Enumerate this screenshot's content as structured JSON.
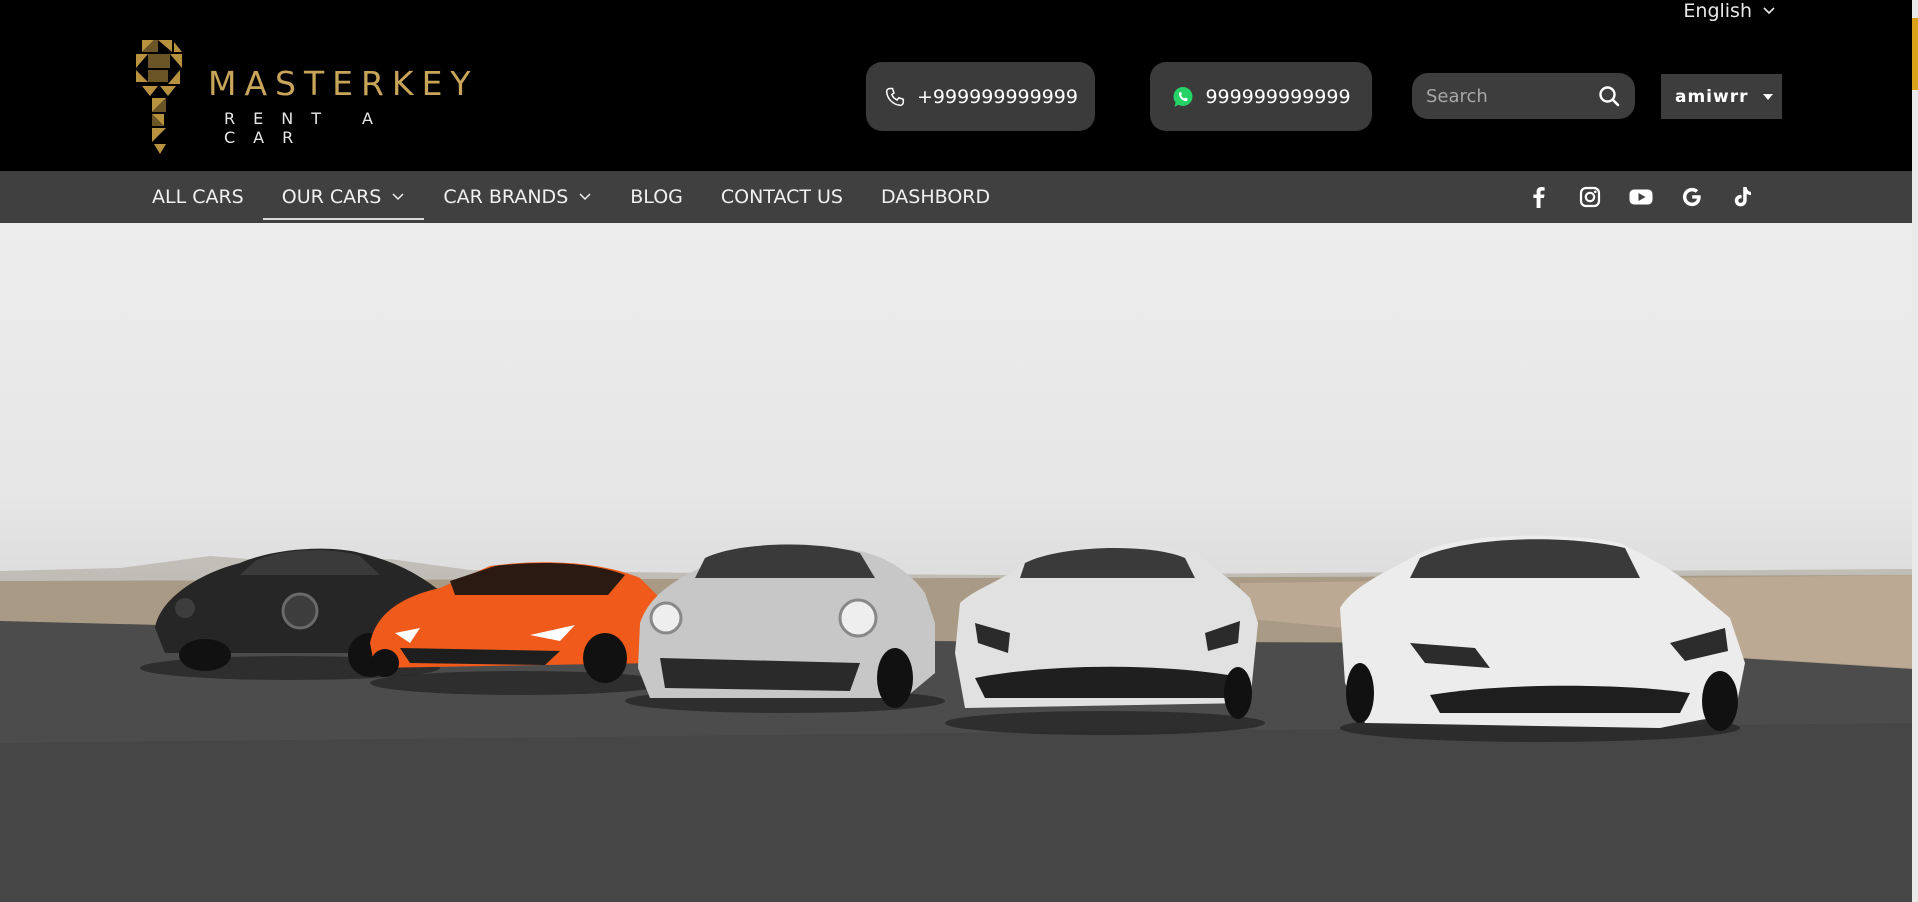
{
  "header": {
    "language": "English",
    "logo": {
      "brand": "MASTERKEY",
      "tagline": "RENT A CAR"
    },
    "phone": "+999999999999",
    "whatsapp": "999999999999",
    "search": {
      "placeholder": "Search",
      "value": ""
    },
    "user": "amiwrr"
  },
  "nav": {
    "items": [
      {
        "label": "ALL CARS"
      },
      {
        "label": "OUR CARS"
      },
      {
        "label": "CAR BRANDS"
      },
      {
        "label": "BLOG"
      },
      {
        "label": "CONTACT US"
      },
      {
        "label": "DASHBORD"
      }
    ],
    "social": [
      "facebook-icon",
      "instagram-icon",
      "youtube-icon",
      "google-icon",
      "tiktok-icon"
    ]
  },
  "hero": {
    "image": "five-supercars-desert-icon",
    "car_colors": [
      "#2a2a2a",
      "#f05a1a",
      "#c9c9c9",
      "#e3e3e3",
      "#ececec"
    ]
  },
  "colors": {
    "brand_gold": "#c9a55a",
    "whatsapp_green": "#25d366",
    "scroll_accent": "#d9a21b"
  }
}
